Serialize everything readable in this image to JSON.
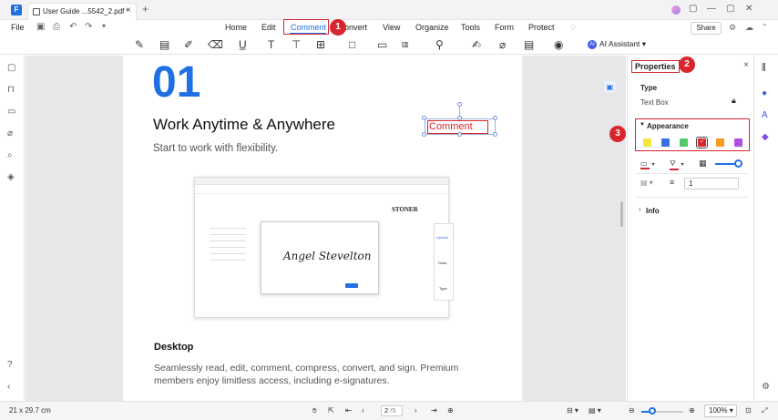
{
  "titlebar": {
    "tab_title": "User Guide ...5542_2.pdf *",
    "close": "×",
    "add": "+"
  },
  "menu": {
    "file": "File",
    "items": [
      "Home",
      "Edit",
      "Comment",
      "Convert",
      "View",
      "Organize",
      "Tools",
      "Form",
      "Protect"
    ],
    "active": "Comment",
    "share": "Share"
  },
  "toolbar": {
    "ai_assistant": "AI Assistant"
  },
  "document": {
    "big_number": "01",
    "heading": "Work Anytime & Anywhere",
    "subheading": "Start to work with flexibility.",
    "desktop_title": "Desktop",
    "desktop_text": "Seamlessly read, edit, comment, compress, convert, and sign. Premium members enjoy limitless access, including e-signatures.",
    "comment_text": "Comment",
    "screenshot": {
      "brand": "STONER",
      "signature": "Angel Stevelton",
      "side_items": [
        "Upload",
        "Draw",
        "Type"
      ]
    }
  },
  "properties": {
    "title": "Properties",
    "close": "×",
    "type_label": "Type",
    "type_value": "Text Box",
    "appearance_label": "Appearance",
    "colors": [
      "#f5e53a",
      "#3b6fe0",
      "#4fc96a",
      "#d9262e",
      "#f59a23",
      "#b04ee0"
    ],
    "selected_color_index": 3,
    "line_width": "1",
    "info_label": "Info",
    "opacity": 1.0
  },
  "callouts": {
    "one": "1",
    "two": "2",
    "three": "3"
  },
  "status": {
    "page_size": "21 x 29.7 cm",
    "page_current": "2",
    "page_total": "/5",
    "zoom": "100%",
    "zoom_fraction": 0.25
  }
}
